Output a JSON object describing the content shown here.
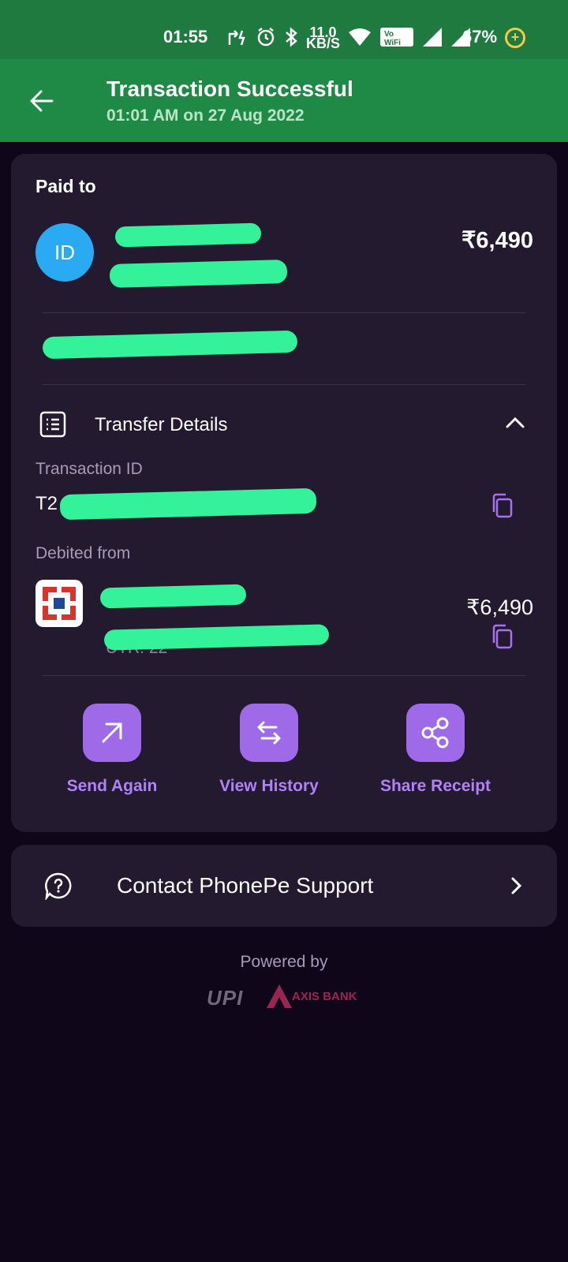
{
  "status_bar": {
    "time": "01:55",
    "net_speed_value": "11.0",
    "net_speed_unit": "KB/S",
    "volte_label": "Vo WiFi",
    "battery": "67%"
  },
  "header": {
    "title": "Transaction Successful",
    "subtitle": "01:01 AM on 27 Aug 2022"
  },
  "paid_to": {
    "label": "Paid to",
    "avatar_initials": "ID",
    "amount": "₹6,490",
    "avatar_color": "#2aaaf2"
  },
  "transfer_details": {
    "label": "Transfer Details",
    "transaction_id_label": "Transaction ID",
    "transaction_id_prefix": "T2",
    "debited_from_label": "Debited from",
    "debited_amount": "₹6,490",
    "utr_prefix": "UTR: 22"
  },
  "actions": [
    {
      "label": "Send Again",
      "icon": "arrow-up-right-icon"
    },
    {
      "label": "View History",
      "icon": "swap-arrows-icon"
    },
    {
      "label": "Share Receipt",
      "icon": "share-icon"
    }
  ],
  "support": {
    "label": "Contact PhonePe Support"
  },
  "footer": {
    "powered_by": "Powered by",
    "upi_logo_text": "UPI",
    "bank_name": "AXIS BANK"
  },
  "colors": {
    "header_green": "#1f8a45",
    "accent_purple": "#9f6ae8",
    "redaction_green": "#33f29a",
    "background": "#0f0719",
    "card": "#231a30"
  }
}
